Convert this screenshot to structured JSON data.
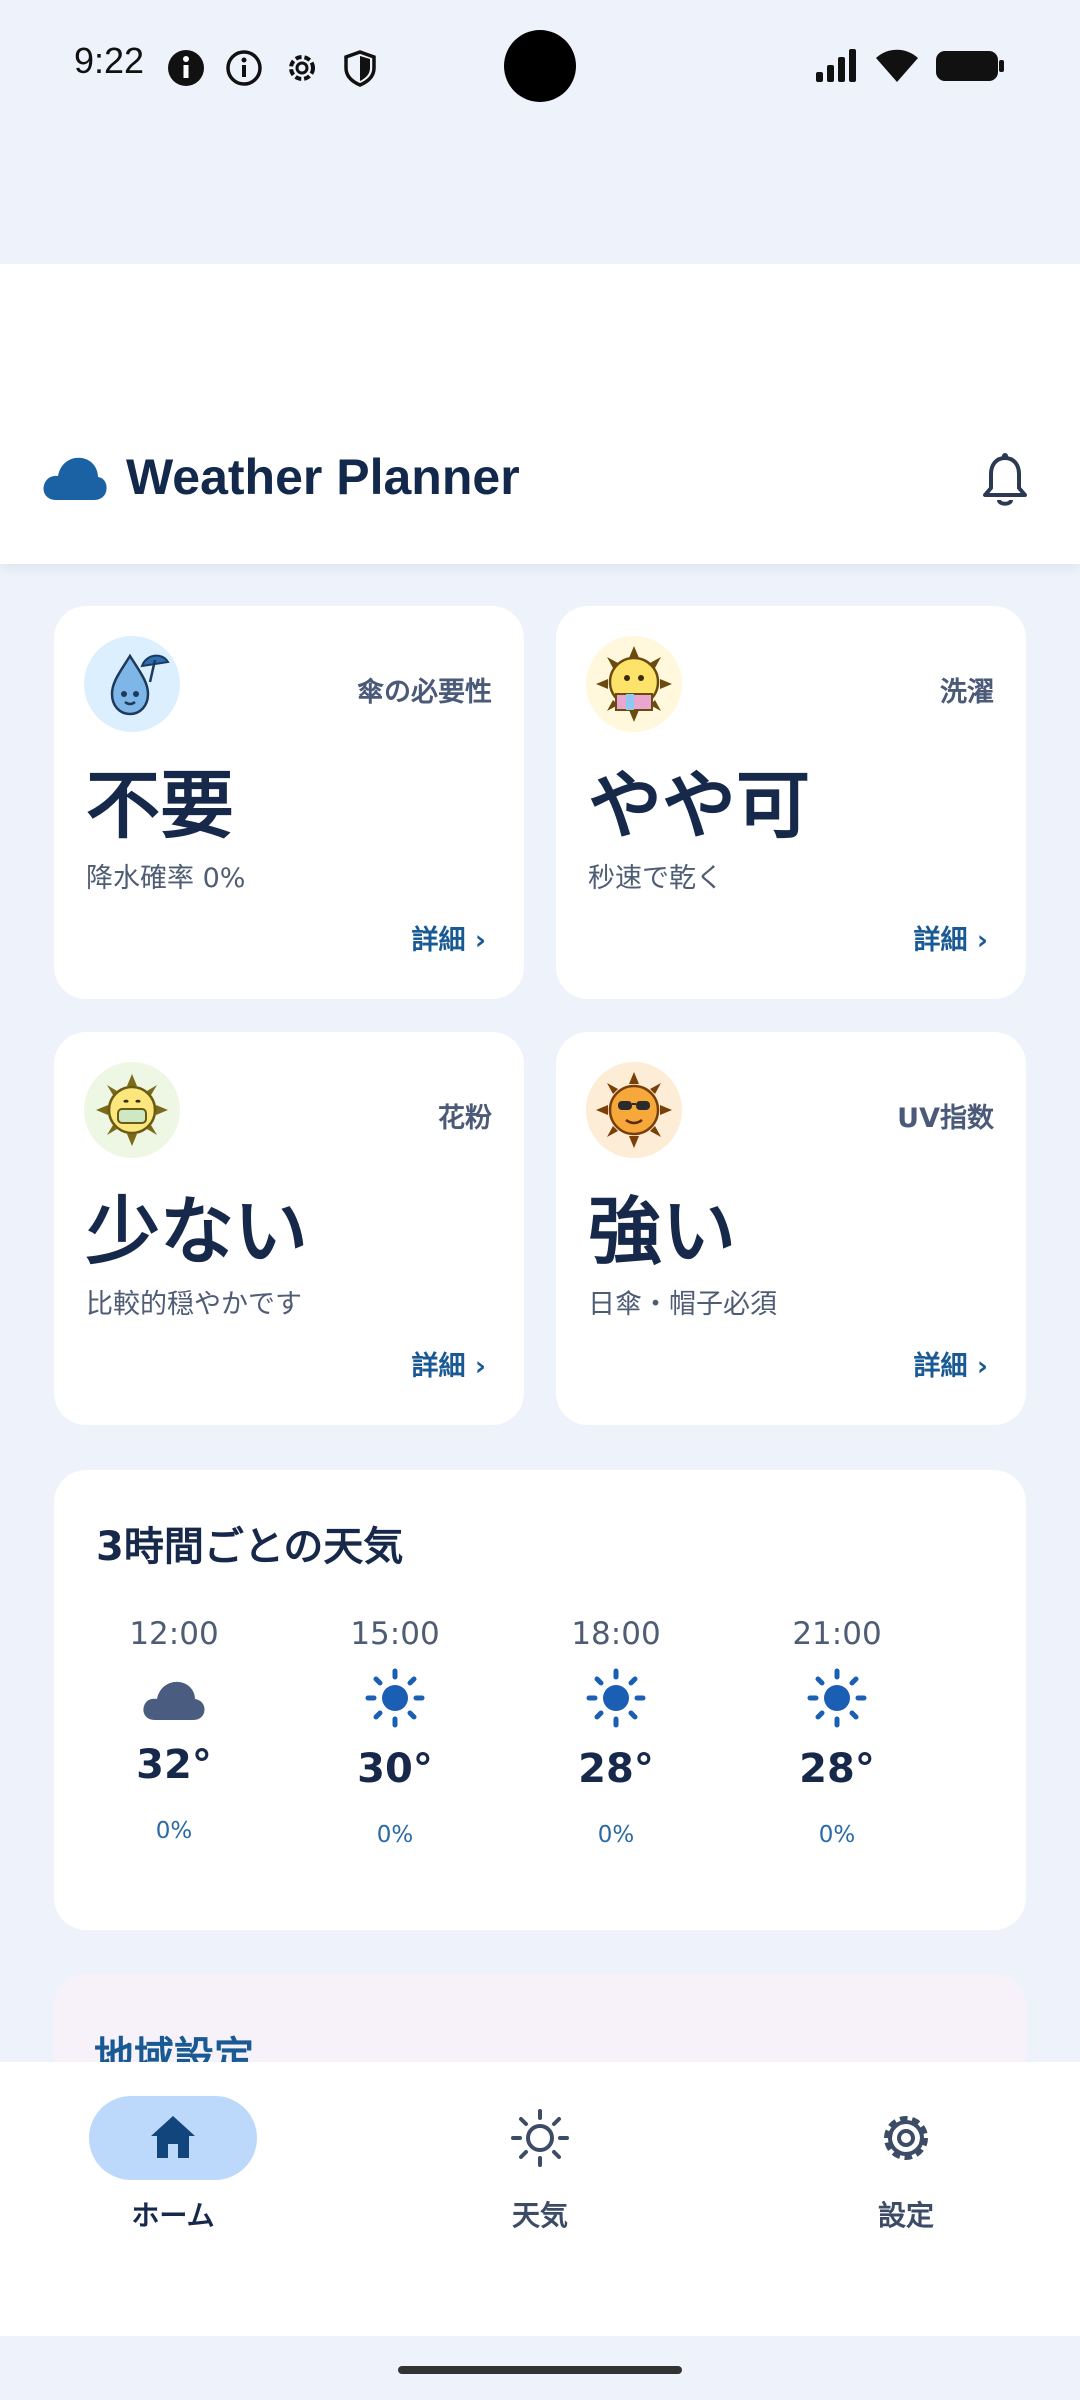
{
  "status_bar": {
    "time": "9:22",
    "left_icons": [
      "info-filled-icon",
      "info-outline-icon",
      "settings-icon",
      "shield-icon"
    ],
    "right_icons": [
      "signal-icon",
      "wifi-icon",
      "battery-icon"
    ]
  },
  "header": {
    "title": "Weather Planner",
    "logo_icon": "cloud-icon",
    "action_icon": "bell-icon"
  },
  "cards": [
    {
      "label": "傘の必要性",
      "value": "不要",
      "sub": "降水確率 0%",
      "link": "詳細",
      "icon": "umbrella-drop-mascot-icon"
    },
    {
      "label": "洗濯",
      "value": "やや可",
      "sub": "秒速で乾く",
      "link": "詳細",
      "icon": "sun-laundry-mascot-icon"
    },
    {
      "label": "花粉",
      "value": "少ない",
      "sub": "比較的穏やかです",
      "link": "詳細",
      "icon": "sun-mask-mascot-icon"
    },
    {
      "label": "UV指数",
      "value": "強い",
      "sub": "日傘・帽子必須",
      "link": "詳細",
      "icon": "sun-sunglasses-mascot-icon"
    }
  ],
  "hourly": {
    "title": "3時間ごとの天気",
    "items": [
      {
        "time": "12:00",
        "icon": "cloud-icon",
        "temp": "32°",
        "rain": "0%"
      },
      {
        "time": "15:00",
        "icon": "sun-icon",
        "temp": "30°",
        "rain": "0%"
      },
      {
        "time": "18:00",
        "icon": "sun-icon",
        "temp": "28°",
        "rain": "0%"
      },
      {
        "time": "21:00",
        "icon": "sun-icon",
        "temp": "28°",
        "rain": "0%"
      }
    ]
  },
  "region": {
    "title": "地域設定"
  },
  "nav": {
    "items": [
      {
        "label": "ホーム",
        "icon": "home-icon",
        "active": true
      },
      {
        "label": "天気",
        "icon": "sun-outline-icon",
        "active": false
      },
      {
        "label": "設定",
        "icon": "gear-icon",
        "active": false
      }
    ]
  },
  "colors": {
    "accent": "#1a5a94",
    "active_pill": "#bcd8fb",
    "background": "#eef2fb"
  }
}
